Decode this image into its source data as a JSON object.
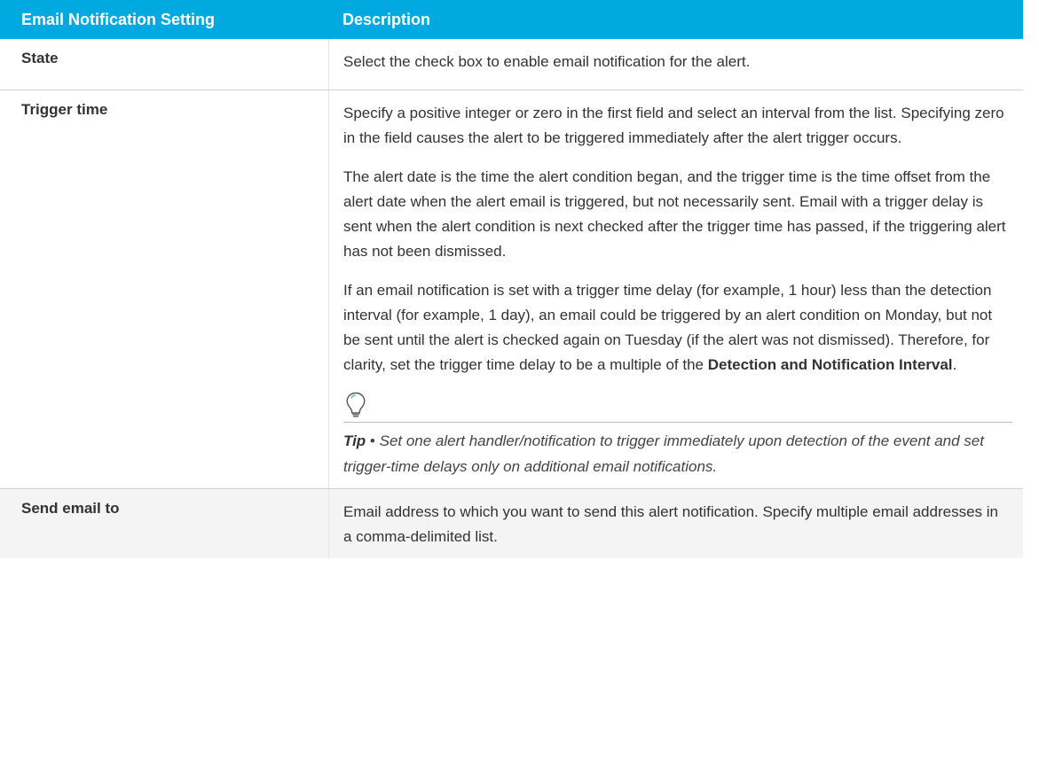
{
  "colors": {
    "header_bg": "#00a9e0",
    "header_text": "#ffffff",
    "row_alt_bg": "#f4f4f4"
  },
  "table": {
    "headers": [
      "Email Notification Setting",
      "Description"
    ],
    "rows": [
      {
        "setting": "State",
        "description": [
          "Select the check box to enable email notification for the alert."
        ]
      },
      {
        "setting": "Trigger time",
        "description": [
          "Specify a positive integer or zero in the first field and select an interval from the list. Specifying zero in the field causes the alert to be triggered immediately after the alert trigger occurs.",
          "The alert date is the time the alert condition began, and the trigger time is the time offset from the alert date when the alert email is triggered, but not necessarily sent. Email with a trigger delay is sent when the alert condition is next checked after the trigger time has passed, if the triggering alert has not been dismissed.",
          {
            "text_before": "If an email notification is set with a trigger time delay (for example, 1 hour) less than the detection interval (for example, 1 day), an email could be triggered by an alert condition on Monday, but not be sent until the alert is checked again on Tuesday (if the alert was not dismissed). Therefore, for clarity, set the trigger time delay to be a multiple of the ",
            "bold": "Detection and Notification Interval",
            "text_after": "."
          }
        ],
        "tip": {
          "icon": "lightbulb-icon",
          "label": "Tip",
          "separator": "•",
          "text": "Set one alert handler/notification to trigger immediately upon detection of the event and set trigger-time delays only on additional email notifications."
        }
      },
      {
        "setting": "Send email to",
        "description": [
          "Email address to which you want to send this alert notification. Specify multiple email addresses in a comma-delimited list."
        ]
      }
    ]
  }
}
